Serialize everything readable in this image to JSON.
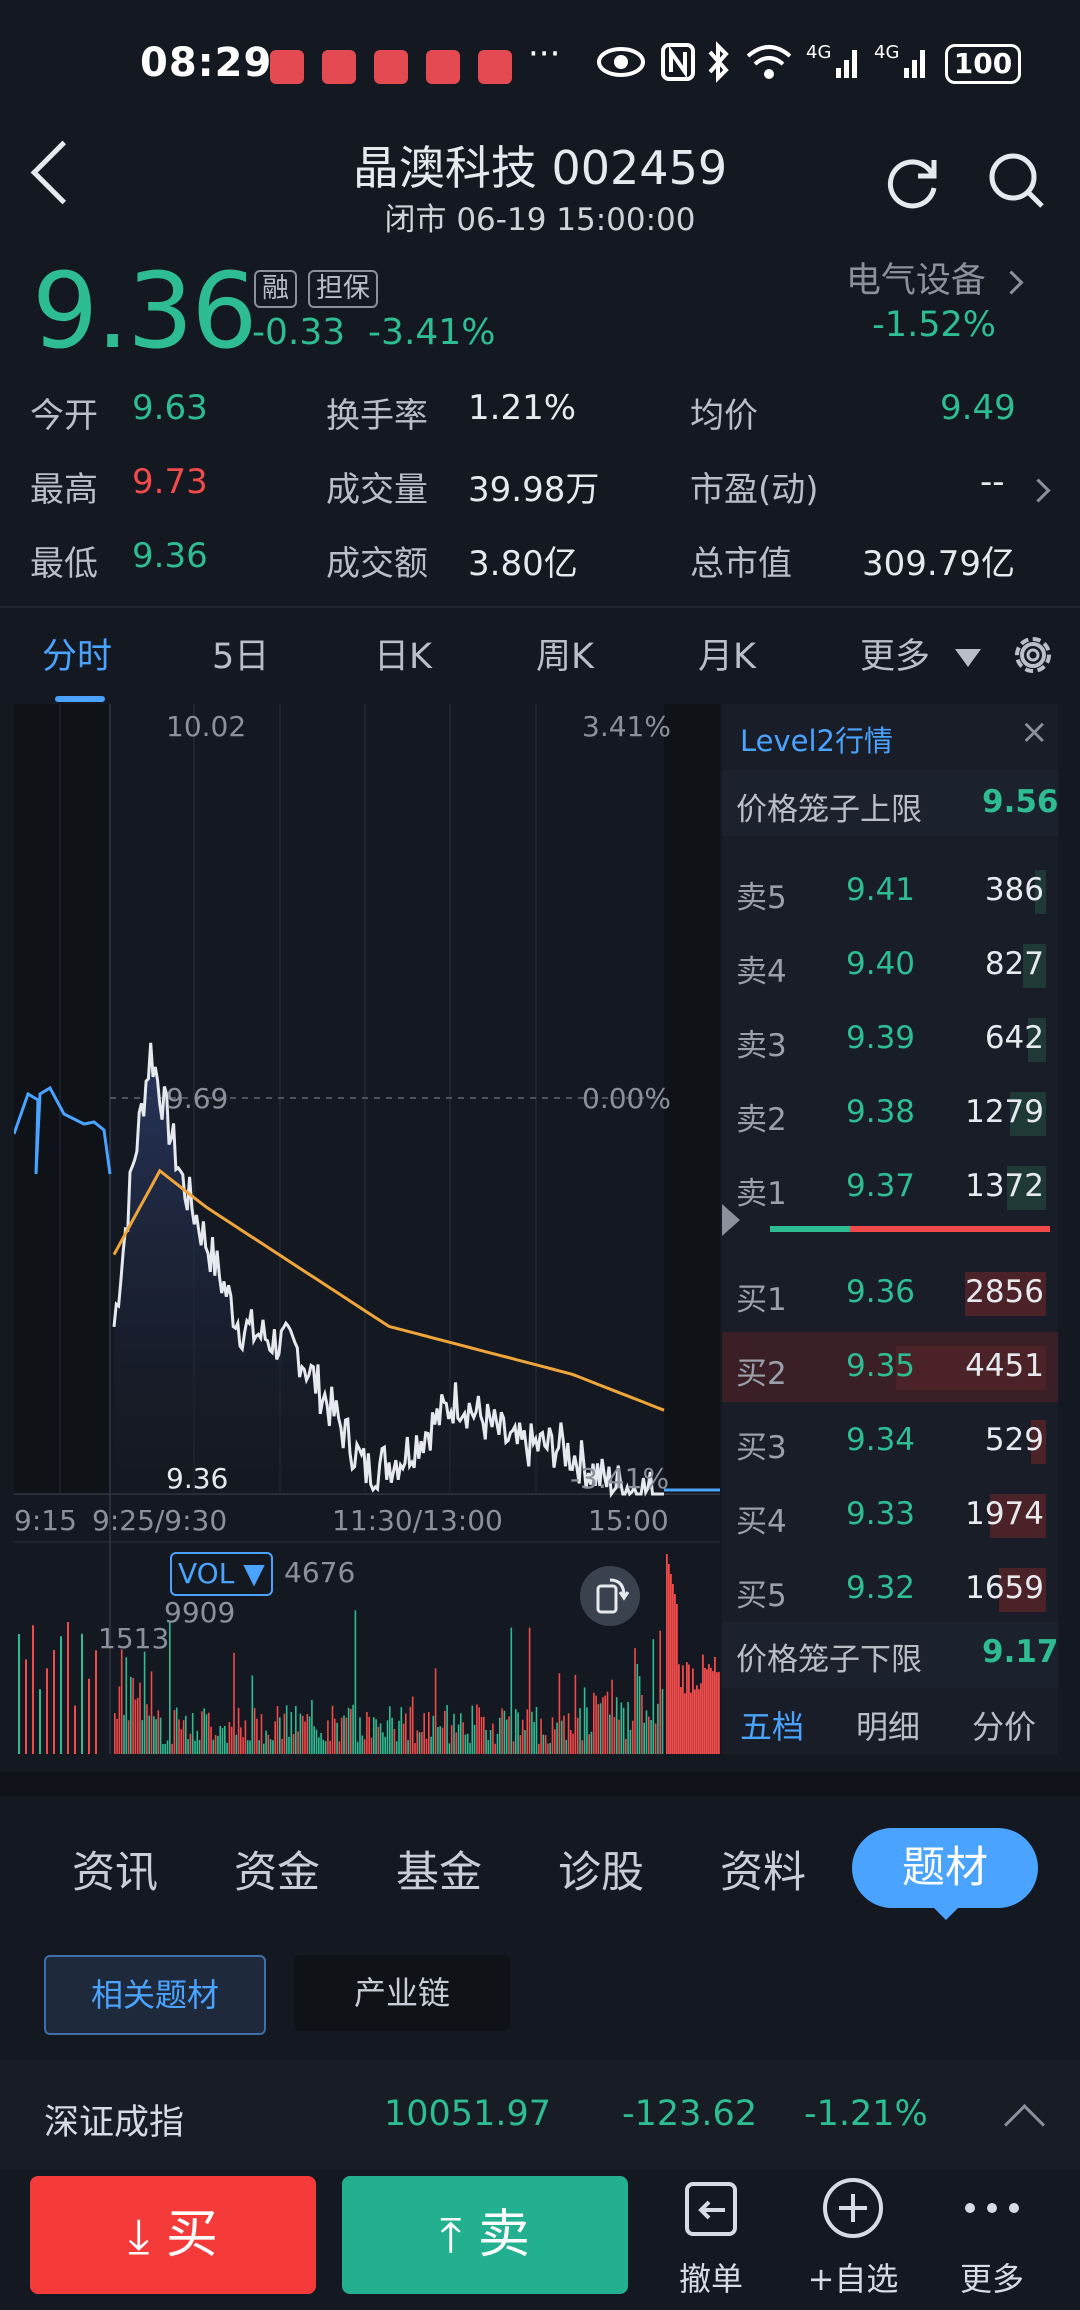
{
  "status": {
    "time": "08:29",
    "dots": "···",
    "battery": "100"
  },
  "header": {
    "title": "晶澳科技 002459",
    "subtitle": "闭市 06-19 15:00:00"
  },
  "quote": {
    "price": "9.36",
    "badge1": "融",
    "badge2": "担保",
    "change": "-0.33",
    "change_pct": "-3.41%",
    "sector": "电气设备",
    "sector_chg": "-1.52%"
  },
  "stats": {
    "open_label": "今开",
    "open": "9.63",
    "high_label": "最高",
    "high": "9.73",
    "low_label": "最低",
    "low": "9.36",
    "turnover_label": "换手率",
    "turnover": "1.21%",
    "volume_label": "成交量",
    "volume": "39.98万",
    "amount_label": "成交额",
    "amount": "3.80亿",
    "avg_label": "均价",
    "avg": "9.49",
    "pe_label": "市盈(动)",
    "pe": "--",
    "mcap_label": "总市值",
    "mcap": "309.79亿"
  },
  "tabs": [
    "分时",
    "5日",
    "日K",
    "周K",
    "月K",
    "更多"
  ],
  "chart": {
    "top_price": "10.02",
    "top_pct": "3.41%",
    "mid_price": "9.69",
    "mid_pct": "0.00%",
    "bot_price": "9.36",
    "bot_pct": "-3.41%",
    "t1": "9:15",
    "t2": "9:25/9:30",
    "t3": "11:30/13:00",
    "t4": "15:00",
    "vol_label": "VOL ▼",
    "vol_val": "4676",
    "vol_max": "9909",
    "vol_mid": "1513"
  },
  "level2": {
    "title": "Level2行情",
    "close": "×",
    "upper_label": "价格笼子上限",
    "upper": "9.56",
    "lower_label": "价格笼子下限",
    "lower": "9.17",
    "asks": [
      {
        "label": "卖5",
        "price": "9.41",
        "vol": "386",
        "share": 0.07
      },
      {
        "label": "卖4",
        "price": "9.40",
        "vol": "827",
        "share": 0.15
      },
      {
        "label": "卖3",
        "price": "9.39",
        "vol": "642",
        "share": 0.12
      },
      {
        "label": "卖2",
        "price": "9.38",
        "vol": "1279",
        "share": 0.24
      },
      {
        "label": "卖1",
        "price": "9.37",
        "vol": "1372",
        "share": 0.26
      }
    ],
    "bids": [
      {
        "label": "买1",
        "price": "9.36",
        "vol": "2856",
        "share": 0.54
      },
      {
        "label": "买2",
        "price": "9.35",
        "vol": "4451",
        "share": 1.0
      },
      {
        "label": "买3",
        "price": "9.34",
        "vol": "529",
        "share": 0.1
      },
      {
        "label": "买4",
        "price": "9.33",
        "vol": "1974",
        "share": 0.37
      },
      {
        "label": "买5",
        "price": "9.32",
        "vol": "1659",
        "share": 0.31
      }
    ],
    "tabs": [
      "五档",
      "明细",
      "分价"
    ]
  },
  "info_tabs": [
    "资讯",
    "资金",
    "基金",
    "诊股",
    "资料",
    "题材"
  ],
  "chips": [
    "相关题材",
    "产业链"
  ],
  "index": {
    "name": "深证成指",
    "value": "10051.97",
    "change": "-123.62",
    "pct": "-1.21%"
  },
  "bottom": {
    "buy": "买",
    "sell": "卖",
    "cancel": "撤单",
    "watch": "+自选",
    "more": "更多"
  },
  "colors": {
    "green": "#2ebd93",
    "red": "#f04a4a",
    "blue": "#4aa3ff",
    "avg": "#f0a53a"
  }
}
